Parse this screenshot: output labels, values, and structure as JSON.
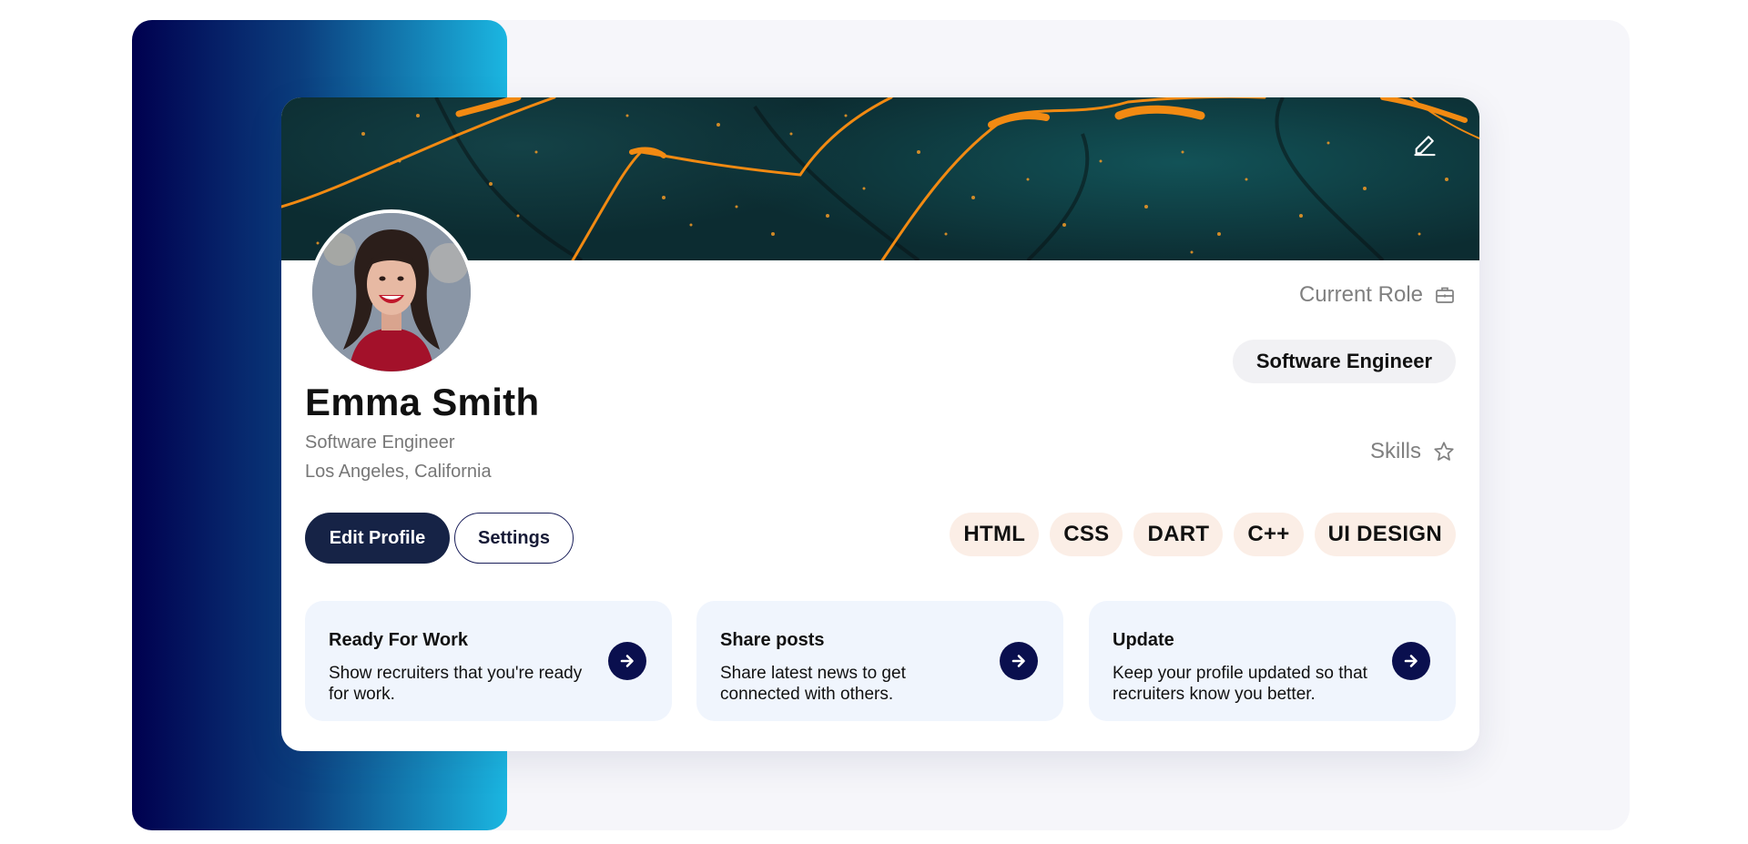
{
  "profile": {
    "name": "Emma Smith",
    "title": "Software Engineer",
    "location": "Los Angeles, California"
  },
  "buttons": {
    "edit_profile": "Edit Profile",
    "settings": "Settings"
  },
  "current_role": {
    "label": "Current Role",
    "value": "Software Engineer"
  },
  "skills": {
    "label": "Skills",
    "items": [
      "HTML",
      "CSS",
      "DART",
      "C++",
      "UI DESIGN"
    ]
  },
  "actions": [
    {
      "title": "Ready For Work",
      "description": "Show recruiters that you're ready for work."
    },
    {
      "title": "Share posts",
      "description": "Share latest news to get connected with others."
    },
    {
      "title": "Update",
      "description": "Keep your profile updated so that recruiters know you better."
    }
  ],
  "icons": {
    "cover_edit": "pencil-icon",
    "current_role": "briefcase-icon",
    "skills": "star-icon",
    "action_arrow": "arrow-right-icon"
  },
  "colors": {
    "primary": "#162346",
    "gradient_start": "#00004f",
    "gradient_end": "#1bb6e1",
    "skill_pill": "#fbeee6",
    "action_card": "#f0f5fd",
    "arrow_button": "#0a0f4e"
  }
}
